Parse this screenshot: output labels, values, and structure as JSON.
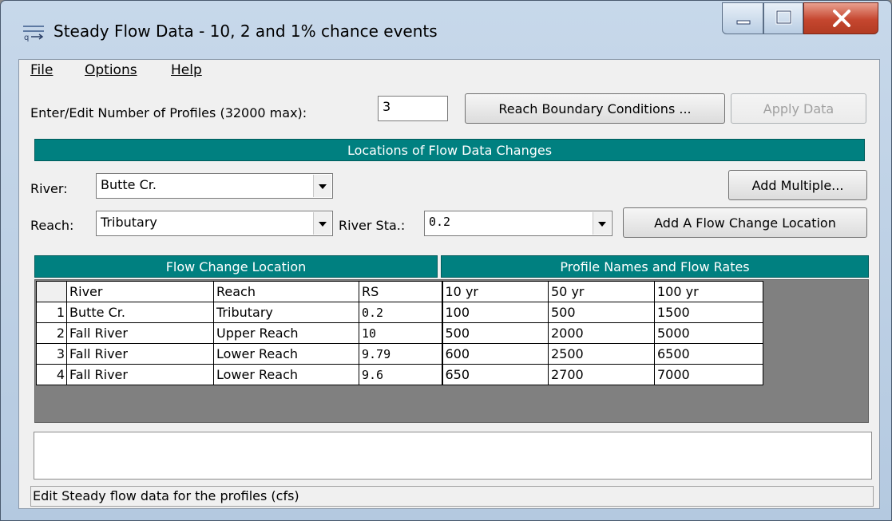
{
  "window": {
    "title": "Steady Flow Data - 10, 2 and 1% chance events",
    "controls": {
      "minimize_icon": "minimize-icon",
      "maximize_icon": "maximize-icon",
      "close_icon": "close-icon"
    }
  },
  "menu": {
    "file": "File",
    "options": "Options",
    "help": "Help"
  },
  "profiles": {
    "label": "Enter/Edit Number of Profiles (32000 max):",
    "value": "3"
  },
  "buttons": {
    "reach_boundary": "Reach Boundary Conditions ...",
    "apply_data": "Apply Data",
    "add_multiple": "Add Multiple...",
    "add_flow_change": "Add A Flow Change Location"
  },
  "locations": {
    "header": "Locations of Flow Data Changes",
    "river_label": "River:",
    "river_value": "Butte Cr.",
    "reach_label": "Reach:",
    "reach_value": "Tributary",
    "station_label": "River Sta.:",
    "station_value": "0.2"
  },
  "table": {
    "left_header": "Flow Change Location",
    "right_header": "Profile Names and Flow Rates",
    "columns": [
      "River",
      "Reach",
      "RS",
      "10 yr",
      "50 yr",
      "100 yr"
    ],
    "rows": [
      {
        "num": "1",
        "river": "Butte Cr.",
        "reach": "Tributary",
        "rs": "0.2",
        "p1": "100",
        "p2": "500",
        "p3": "1500"
      },
      {
        "num": "2",
        "river": "Fall River",
        "reach": "Upper Reach",
        "rs": "10",
        "p1": "500",
        "p2": "2000",
        "p3": "5000"
      },
      {
        "num": "3",
        "river": "Fall River",
        "reach": "Lower Reach",
        "rs": "9.79",
        "p1": "600",
        "p2": "2500",
        "p3": "6500"
      },
      {
        "num": "4",
        "river": "Fall River",
        "reach": "Lower Reach",
        "rs": "9.6",
        "p1": "650",
        "p2": "2700",
        "p3": "7000"
      }
    ]
  },
  "status": "Edit Steady flow data for the profiles (cfs)",
  "colors": {
    "accent": "#008080",
    "grid_bg": "#808080",
    "close": "#c5462f"
  }
}
